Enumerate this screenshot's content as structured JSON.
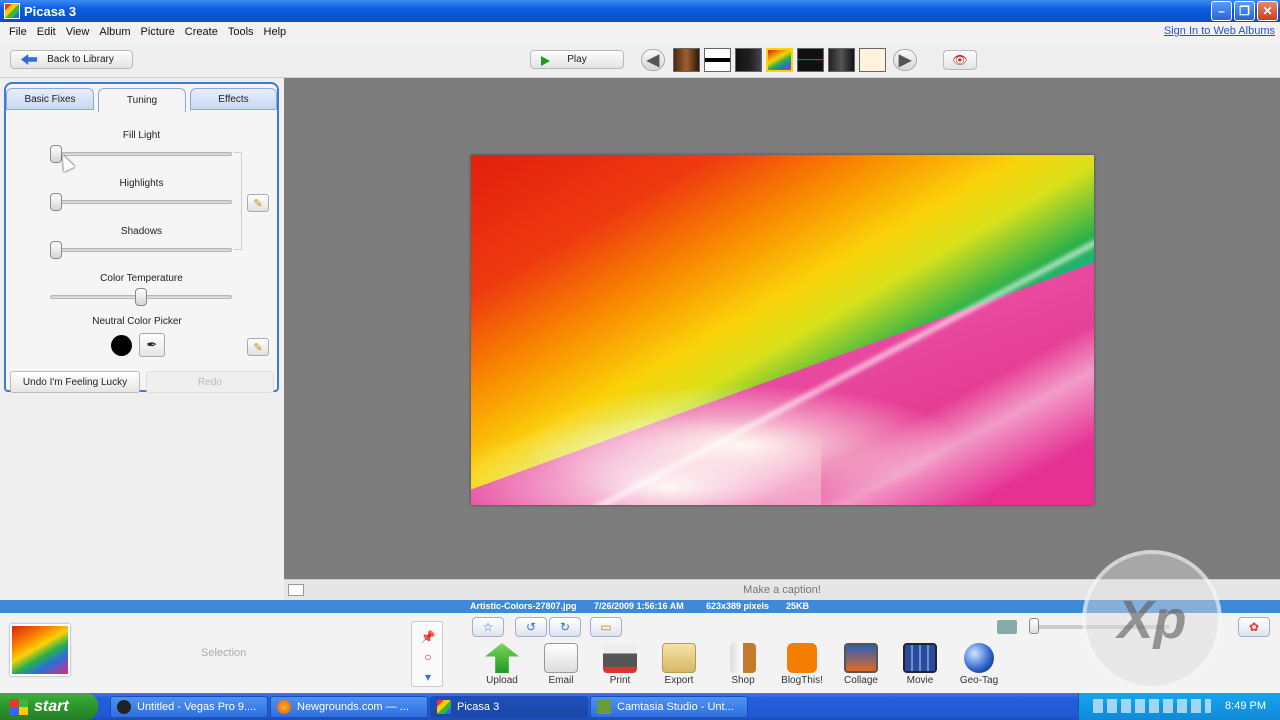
{
  "window": {
    "title": "Picasa 3"
  },
  "menu": {
    "items": [
      "File",
      "Edit",
      "View",
      "Album",
      "Picture",
      "Create",
      "Tools",
      "Help"
    ],
    "signin": "Sign In to Web Albums"
  },
  "toolbar": {
    "back_label": "Back to Library",
    "play_label": "Play"
  },
  "tabs": [
    "Basic Fixes",
    "Tuning",
    "Effects"
  ],
  "tuning": {
    "fill_light": {
      "label": "Fill Light",
      "value": 0
    },
    "highlights": {
      "label": "Highlights",
      "value": 0
    },
    "shadows": {
      "label": "Shadows",
      "value": 0
    },
    "color_temperature": {
      "label": "Color Temperature",
      "value": 0.5
    },
    "neutral_color_picker": {
      "label": "Neutral Color Picker"
    },
    "undo_label": "Undo I'm Feeling Lucky",
    "redo_label": "Redo"
  },
  "caption": {
    "placeholder": "Make a caption!"
  },
  "info": {
    "filename": "Artistic-Colors-27807.jpg",
    "date": "7/26/2009 1:56:16 AM",
    "dimensions": "623x389 pixels",
    "size": "25KB"
  },
  "tray": {
    "selection_label": "Selection",
    "actions": [
      "Upload",
      "Email",
      "Print",
      "Export",
      "Shop",
      "BlogThis!",
      "Collage",
      "Movie",
      "Geo-Tag"
    ]
  },
  "watermark": "Xp",
  "taskbar": {
    "start_label": "start",
    "tasks": [
      "Untitled - Vegas Pro 9....",
      "Newgrounds.com — ...",
      "Picasa 3",
      "Camtasia Studio - Unt..."
    ],
    "clock": "8:49 PM"
  }
}
